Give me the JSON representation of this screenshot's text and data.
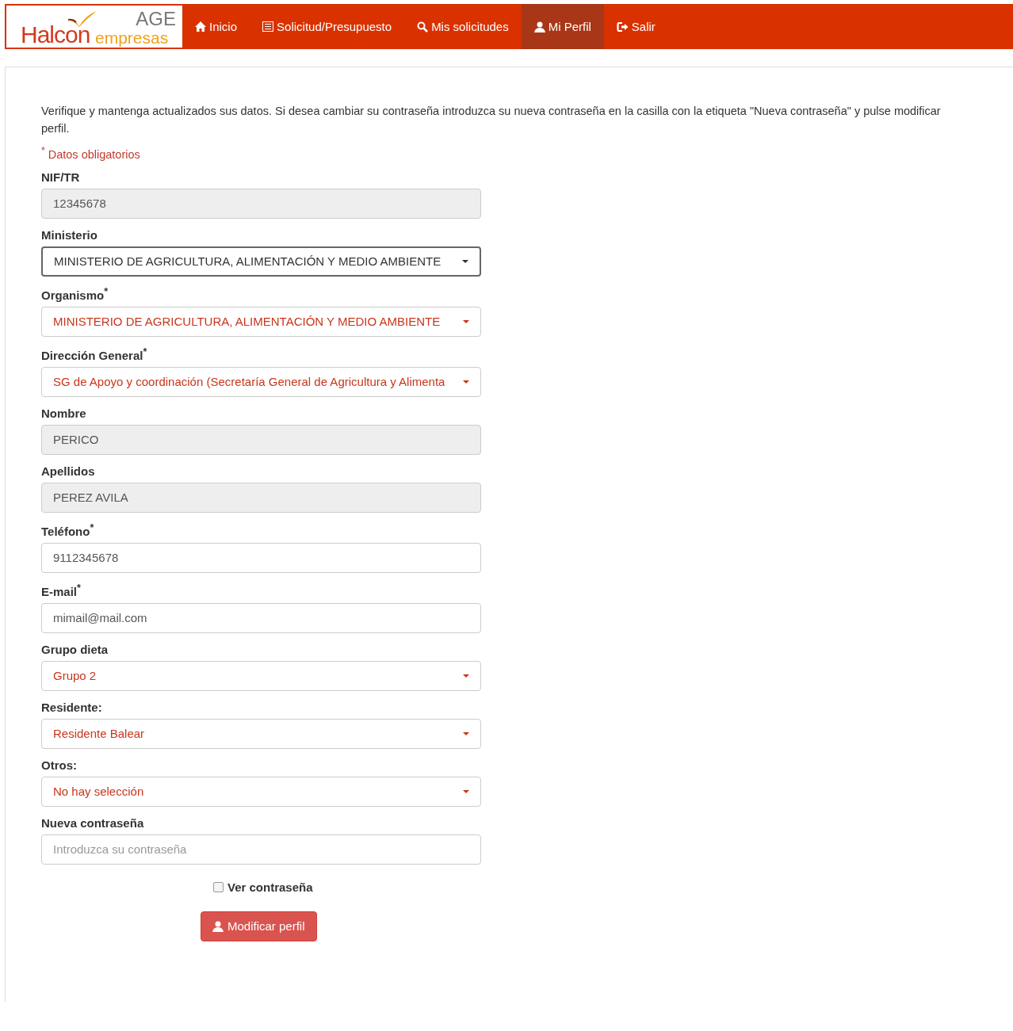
{
  "logo": {
    "brand": "Halcon",
    "sub": "empresas",
    "tag": "AGE"
  },
  "nav": [
    {
      "label": "Inicio",
      "selected": false
    },
    {
      "label": "Solicitud/Presupuesto",
      "selected": false
    },
    {
      "label": "Mis solicitudes",
      "selected": false
    },
    {
      "label": "Mi Perfil",
      "selected": true
    },
    {
      "label": "Salir",
      "selected": false
    }
  ],
  "intro": "Verifique y mantenga actualizados sus datos. Si desea cambiar su contraseña introduzca su nueva contraseña en la casilla con la etiqueta \"Nueva contraseña\" y pulse modificar perfil.",
  "required_note": "$^{*}$ Datos obligatorios",
  "fields": [
    {
      "kind": "readonly",
      "label": "NIF/TR",
      "value": "12345678"
    },
    {
      "kind": "select",
      "label": "Ministerio",
      "value": "MINISTERIO DE AGRICULTURA, ALIMENTACIÓN Y MEDIO AMBIENTE",
      "focused": true
    },
    {
      "kind": "select",
      "label": "Organismo$^{*}$",
      "value": "MINISTERIO DE AGRICULTURA, ALIMENTACIÓN Y MEDIO AMBIENTE",
      "focused": false
    },
    {
      "kind": "select",
      "label": "Dirección General$^{*}$",
      "value": "SG de Apoyo y coordinación (Secretaría General de Agricultura y Alimenta",
      "focused": false
    },
    {
      "kind": "readonly",
      "label": "Nombre",
      "value": "PERICO"
    },
    {
      "kind": "readonly",
      "label": "Apellidos",
      "value": "PEREZ AVILA"
    },
    {
      "kind": "input",
      "label": "Teléfono$^{*}$",
      "value": "9112345678"
    },
    {
      "kind": "input",
      "label": "E-mail$^{*}$",
      "value": "mimail@mail.com"
    },
    {
      "kind": "select",
      "label": "Grupo dieta",
      "value": "Grupo 2",
      "focused": false
    },
    {
      "kind": "select",
      "label": "Residente:",
      "value": "Residente Balear",
      "focused": false
    },
    {
      "kind": "select",
      "label": "Otros:",
      "value": "No hay selección",
      "focused": false
    },
    {
      "kind": "password",
      "label": "Nueva contraseña",
      "placeholder": "Introduzca su contraseña"
    }
  ],
  "show_password": {
    "label": "Ver contraseña",
    "checked": false
  },
  "submit": "Modificar perfil"
}
